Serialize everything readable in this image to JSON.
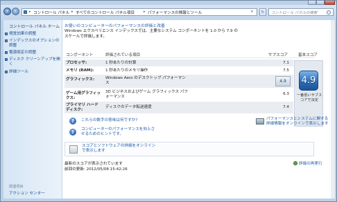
{
  "address": {
    "crumbs": [
      "コントロール パネル",
      "すべてのコントロール パネル項目",
      "パフォーマンスの情報とツール"
    ],
    "refresh_icon": "refresh-icon"
  },
  "search": {
    "placeholder": "コントロール パネルの検索"
  },
  "sidebar": {
    "home": "コントロール パネル ホーム",
    "links": [
      "視覚効果の調整",
      "インデックスのオプションの調整",
      "電源設定の調整",
      "ディスク クリーンアップを開く",
      "詳細ツール"
    ],
    "see_also": "関連項目",
    "footer": "アクション センター"
  },
  "main": {
    "header_link": "お使いのコンピューターのパフォーマンスの評価と改善",
    "intro": "Windows エクスペリエンス インデックスでは、主要なシステム コンポーネントを 1.0 から 7.9 のスケールで評価します。",
    "table": {
      "headers": {
        "component": "コンポーネント",
        "rated": "評価されている項目",
        "subscore": "サブスコア",
        "base": "基本スコア"
      },
      "rows": [
        {
          "component": "プロセッサ:",
          "desc": "1 秒あたりの計算",
          "score": "7.1"
        },
        {
          "component": "メモリ (RAM):",
          "desc": "1 秒あたりのメモリ操作",
          "score": "7.5"
        },
        {
          "component": "グラフィックス:",
          "desc": "Windows Aero のデスクトップ パフォーマンス",
          "score": "4.9"
        },
        {
          "component": "ゲーム用グラフィックス:",
          "desc": "3D ビジネスおよびゲーム グラフィックス パフォーマンス",
          "score": "6.3"
        },
        {
          "component": "プライマリ ハード ディスク:",
          "desc": "ディスクのデータ転送速度",
          "score": "7.4"
        }
      ],
      "base_score": "4.9",
      "base_label": "一番低いサブスコアで決定"
    },
    "links": [
      "これらの数字の意味は何ですか?",
      "コンピューターのパフォーマンスを向上させるためのヒントです。"
    ],
    "right_link": "パフォーマンスとシステムに関する詳細情報をオンラインで表示します",
    "update_link": "スコアとソフトウェアの詳細をオンラインで表示します",
    "status": "最新のスコアが表示されています",
    "last_update": "前回の更新: 2012/05/08 15:42:26",
    "rerun": "評価の再実行"
  }
}
